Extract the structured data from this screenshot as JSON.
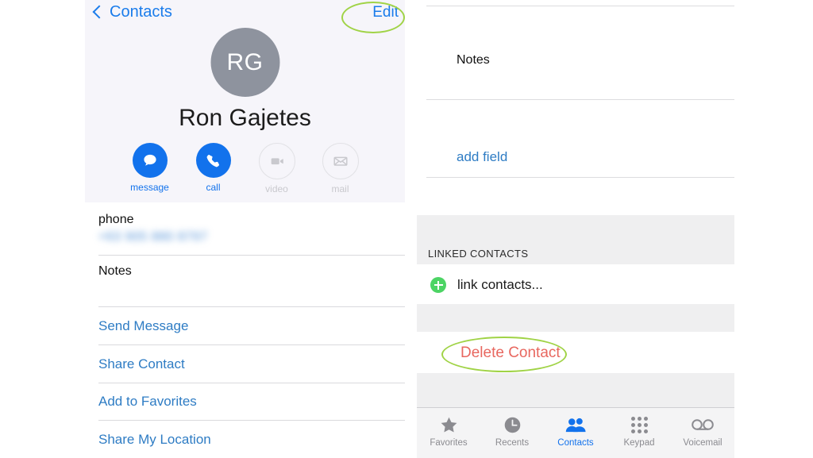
{
  "left": {
    "nav": {
      "back_label": "Contacts",
      "edit_label": "Edit"
    },
    "avatar_initials": "RG",
    "contact_name": "Ron Gajetes",
    "actions": [
      {
        "label": "message",
        "icon": "message-bubble-icon",
        "state": "active"
      },
      {
        "label": "call",
        "icon": "phone-handset-icon",
        "state": "active"
      },
      {
        "label": "video",
        "icon": "video-camera-icon",
        "state": "disabled"
      },
      {
        "label": "mail",
        "icon": "envelope-icon",
        "state": "disabled"
      }
    ],
    "fields": [
      {
        "label": "phone",
        "value": "+63 905 880 8797",
        "redacted": true
      },
      {
        "label": "Notes",
        "value": "",
        "redacted": false
      }
    ],
    "links": [
      "Send Message",
      "Share Contact",
      "Add to Favorites",
      "Share My Location"
    ]
  },
  "right": {
    "notes_label": "Notes",
    "add_field_label": "add field",
    "linked_contacts_header": "LINKED CONTACTS",
    "link_contacts_label": "link contacts...",
    "delete_contact_label": "Delete Contact",
    "tabs": [
      {
        "label": "Favorites",
        "icon": "star-icon",
        "active": false
      },
      {
        "label": "Recents",
        "icon": "clock-icon",
        "active": false
      },
      {
        "label": "Contacts",
        "icon": "contacts-people-icon",
        "active": true
      },
      {
        "label": "Keypad",
        "icon": "keypad-dots-icon",
        "active": false
      },
      {
        "label": "Voicemail",
        "icon": "voicemail-reels-icon",
        "active": false
      }
    ]
  },
  "annotations": {
    "edit_highlight": "green-ellipse-around-edit",
    "delete_highlight": "green-ellipse-around-delete-contact"
  },
  "colors": {
    "accent_blue": "#1272ec",
    "link_blue": "#2e7cc4",
    "delete_red": "#e8675f",
    "annotation_green": "#a0d346",
    "plus_green": "#4cd464",
    "avatar_gray": "#8e939e",
    "band_gray": "#efeff0",
    "header_bg": "#f6f5fa"
  }
}
